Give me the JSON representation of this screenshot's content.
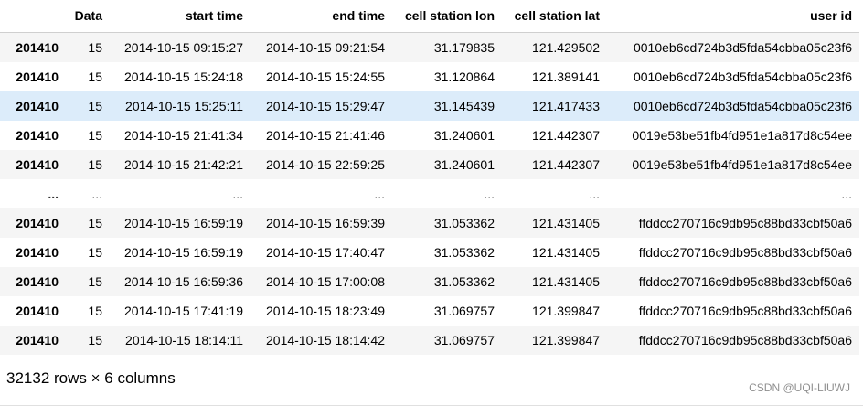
{
  "table": {
    "columns": [
      "",
      "Data",
      "start time",
      "end time",
      "cell station lon",
      "cell station lat",
      "user id"
    ],
    "rows": [
      {
        "index": "201410",
        "cells": [
          "15",
          "2014-10-15 09:15:27",
          "2014-10-15 09:21:54",
          "31.179835",
          "121.429502",
          "0010eb6cd724b3d5fda54cbba05c23f6"
        ]
      },
      {
        "index": "201410",
        "cells": [
          "15",
          "2014-10-15 15:24:18",
          "2014-10-15 15:24:55",
          "31.120864",
          "121.389141",
          "0010eb6cd724b3d5fda54cbba05c23f6"
        ]
      },
      {
        "index": "201410",
        "cells": [
          "15",
          "2014-10-15 15:25:11",
          "2014-10-15 15:29:47",
          "31.145439",
          "121.417433",
          "0010eb6cd724b3d5fda54cbba05c23f6"
        ]
      },
      {
        "index": "201410",
        "cells": [
          "15",
          "2014-10-15 21:41:34",
          "2014-10-15 21:41:46",
          "31.240601",
          "121.442307",
          "0019e53be51fb4fd951e1a817d8c54ee"
        ]
      },
      {
        "index": "201410",
        "cells": [
          "15",
          "2014-10-15 21:42:21",
          "2014-10-15 22:59:25",
          "31.240601",
          "121.442307",
          "0019e53be51fb4fd951e1a817d8c54ee"
        ]
      },
      {
        "index": "...",
        "cells": [
          "...",
          "...",
          "...",
          "...",
          "...",
          "..."
        ]
      },
      {
        "index": "201410",
        "cells": [
          "15",
          "2014-10-15 16:59:19",
          "2014-10-15 16:59:39",
          "31.053362",
          "121.431405",
          "ffddcc270716c9db95c88bd33cbf50a6"
        ]
      },
      {
        "index": "201410",
        "cells": [
          "15",
          "2014-10-15 16:59:19",
          "2014-10-15 17:40:47",
          "31.053362",
          "121.431405",
          "ffddcc270716c9db95c88bd33cbf50a6"
        ]
      },
      {
        "index": "201410",
        "cells": [
          "15",
          "2014-10-15 16:59:36",
          "2014-10-15 17:00:08",
          "31.053362",
          "121.431405",
          "ffddcc270716c9db95c88bd33cbf50a6"
        ]
      },
      {
        "index": "201410",
        "cells": [
          "15",
          "2014-10-15 17:41:19",
          "2014-10-15 18:23:49",
          "31.069757",
          "121.399847",
          "ffddcc270716c9db95c88bd33cbf50a6"
        ]
      },
      {
        "index": "201410",
        "cells": [
          "15",
          "2014-10-15 18:14:11",
          "2014-10-15 18:14:42",
          "31.069757",
          "121.399847",
          "ffddcc270716c9db95c88bd33cbf50a6"
        ]
      }
    ],
    "highlighted_row": 2,
    "colors": {
      "stripe": "#f5f5f5",
      "highlight": "#dcecfa"
    }
  },
  "summary": "32132 rows × 6 columns",
  "watermark": "CSDN @UQI-LIUWJ"
}
